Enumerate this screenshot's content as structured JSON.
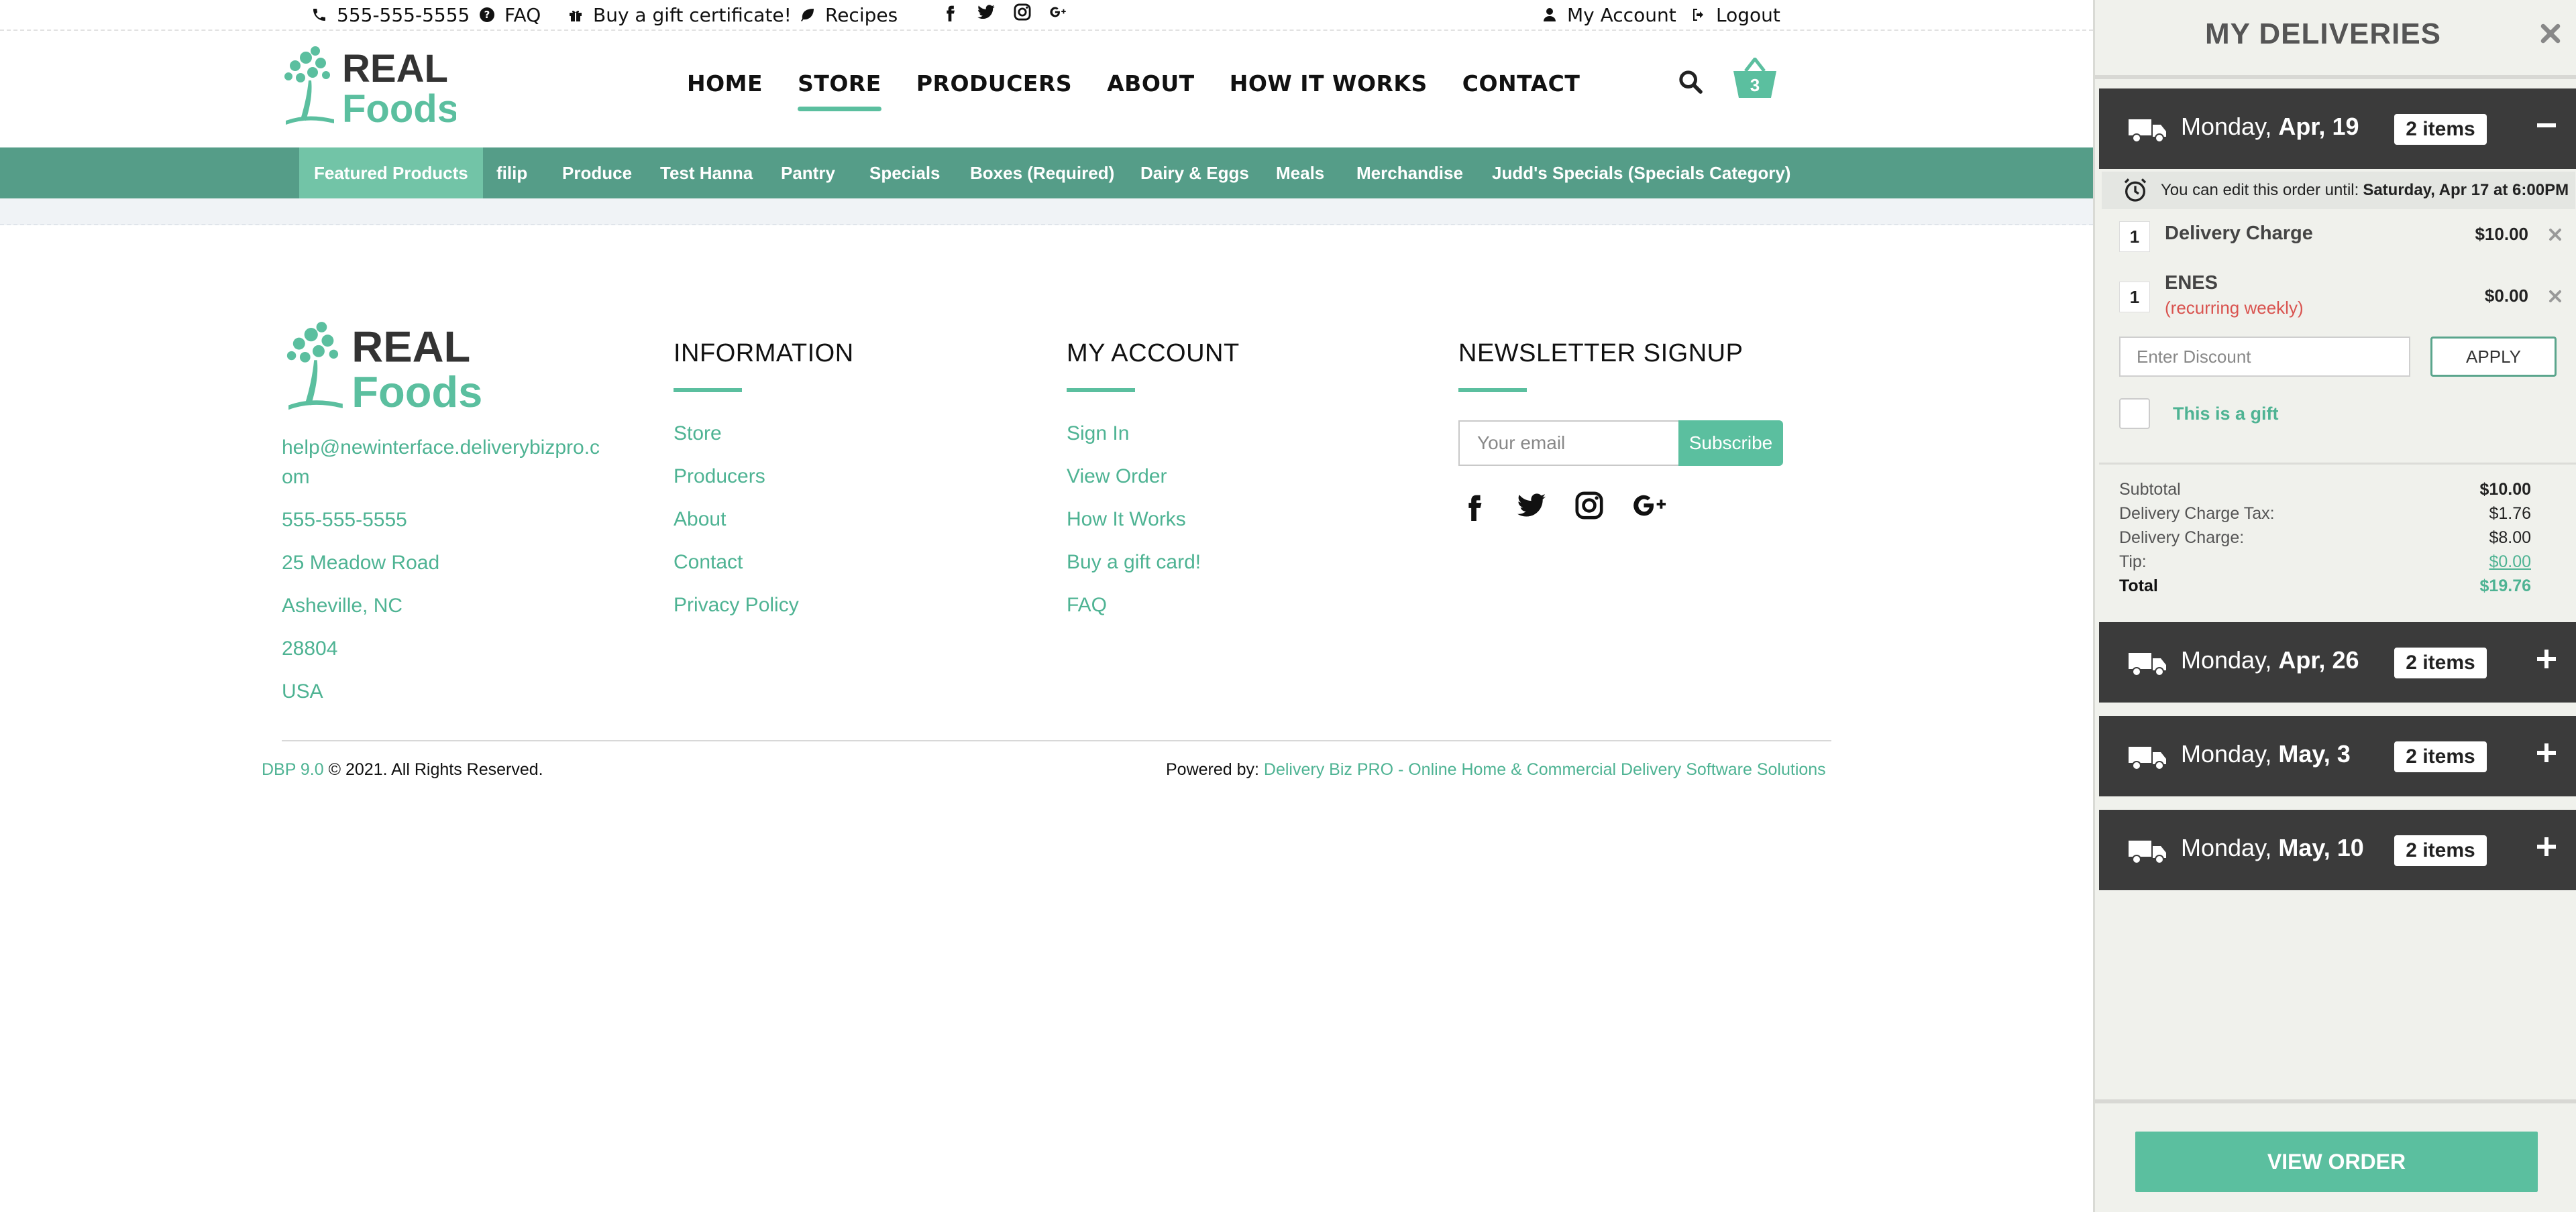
{
  "topbar": {
    "phone": "555-555-5555",
    "faq": "FAQ",
    "gift": "Buy a gift certificate!",
    "recipes": "Recipes",
    "account": "My Account",
    "logout": "Logout"
  },
  "logo": {
    "line1": "REAL",
    "line2": "Foods"
  },
  "nav": {
    "home": "HOME",
    "store": "STORE",
    "producers": "PRODUCERS",
    "about": "ABOUT",
    "how": "HOW IT WORKS",
    "contact": "CONTACT",
    "cart_count": "3"
  },
  "categories": [
    "Featured Products",
    "filip",
    "Produce",
    "Test Hanna",
    "Pantry",
    "Specials",
    "Boxes (Required)",
    "Dairy & Eggs",
    "Meals",
    "Merchandise",
    "Judd's Specials (Specials Category)"
  ],
  "footer": {
    "contact": {
      "email_line1": "help@newinterface.deliverybizpro.c",
      "email_line2": "om",
      "phone": "555-555-5555",
      "street": "25 Meadow Road",
      "city": "Asheville, NC",
      "zip": "28804",
      "country": "USA"
    },
    "information": {
      "heading": "INFORMATION",
      "links": [
        "Store",
        "Producers",
        "About",
        "Contact",
        "Privacy Policy"
      ]
    },
    "account": {
      "heading": "MY ACCOUNT",
      "links": [
        "Sign In",
        "View Order",
        "How It Works",
        "Buy a gift card!",
        "FAQ"
      ]
    },
    "newsletter": {
      "heading": "NEWSLETTER SIGNUP",
      "placeholder": "Your email",
      "button": "Subscribe"
    },
    "version": "DBP 9.0",
    "copyright": "© 2021. All Rights Reserved.",
    "powered_label": "Powered by:",
    "powered_link": "Delivery Biz PRO - Online Home & Commercial Delivery Software Solutions"
  },
  "sidebar": {
    "title": "MY DELIVERIES",
    "deliveries": [
      {
        "weekday": "Monday,",
        "date": "Apr, 19",
        "items": "2 items",
        "toggle": "minus"
      },
      {
        "weekday": "Monday,",
        "date": "Apr, 26",
        "items": "2 items",
        "toggle": "plus"
      },
      {
        "weekday": "Monday,",
        "date": "May, 3",
        "items": "2 items",
        "toggle": "plus"
      },
      {
        "weekday": "Monday,",
        "date": "May, 10",
        "items": "2 items",
        "toggle": "plus"
      }
    ],
    "edit_note": "You can edit this order until:",
    "edit_deadline": "Saturday, Apr 17 at 6:00PM",
    "order_items": [
      {
        "qty": "1",
        "name": "Delivery Charge",
        "sub": "",
        "price": "$10.00"
      },
      {
        "qty": "1",
        "name": "ENES",
        "sub": "(recurring weekly)",
        "price": "$0.00"
      }
    ],
    "discount_placeholder": "Enter Discount",
    "apply": "APPLY",
    "gift_label": "This is a gift",
    "summary": {
      "subtotal_label": "Subtotal",
      "subtotal": "$10.00",
      "tax_label": "Delivery Charge Tax:",
      "tax": "$1.76",
      "charge_label": "Delivery Charge:",
      "charge": "$8.00",
      "tip_label": "Tip:",
      "tip": "$0.00",
      "total_label": "Total",
      "total": "$19.76"
    },
    "view_order": "VIEW ORDER"
  },
  "colors": {
    "accent": "#5bbf9f",
    "category_bar": "#559d88",
    "delivery_header": "#3b3b3b",
    "recurring_red": "#d9534f"
  }
}
